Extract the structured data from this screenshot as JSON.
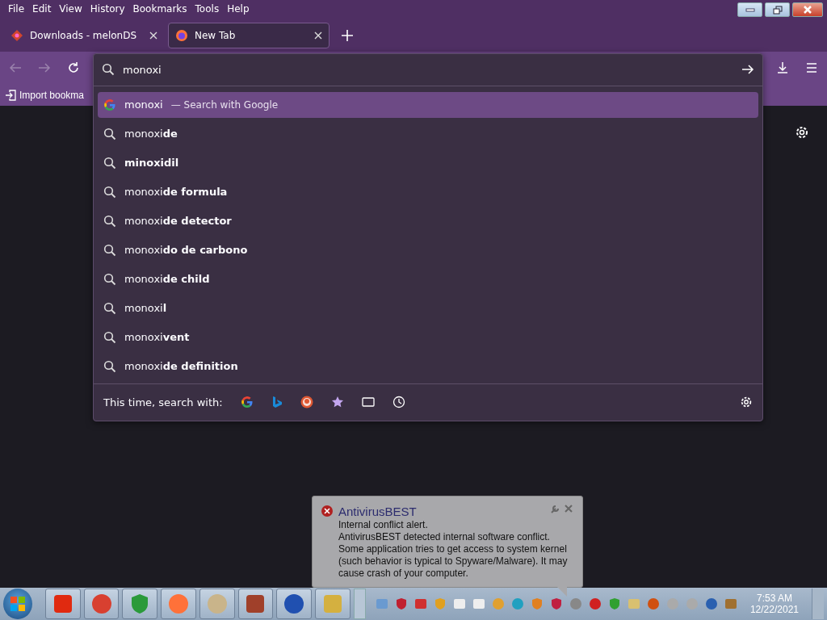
{
  "menu_bar": [
    "File",
    "Edit",
    "View",
    "History",
    "Bookmarks",
    "Tools",
    "Help"
  ],
  "tabs": [
    {
      "title": "Downloads - melonDS",
      "selected": false
    },
    {
      "title": "New Tab",
      "selected": true
    }
  ],
  "address_bar": {
    "value": "monoxi"
  },
  "bookmarks_bar": {
    "import_label": "Import bookma"
  },
  "suggestions": [
    {
      "kind": "engine",
      "text": "monoxi",
      "hint": "— Search with Google",
      "selected": true
    },
    {
      "kind": "search",
      "text": "monoxi**de**",
      "selected": false
    },
    {
      "kind": "search",
      "text": "**minoxidil**",
      "selected": false
    },
    {
      "kind": "search",
      "text": "monoxi**de formula**",
      "selected": false
    },
    {
      "kind": "search",
      "text": "monoxi**de detector**",
      "selected": false
    },
    {
      "kind": "search",
      "text": "monoxi**do de carbono**",
      "selected": false
    },
    {
      "kind": "search",
      "text": "monoxi**de child**",
      "selected": false
    },
    {
      "kind": "search",
      "text": "monoxi**l**",
      "selected": false
    },
    {
      "kind": "search",
      "text": "monoxi**vent**",
      "selected": false
    },
    {
      "kind": "search",
      "text": "monoxi**de definition**",
      "selected": false
    }
  ],
  "search_with_label": "This time, search with:",
  "notification": {
    "title": "AntivirusBEST",
    "lines": [
      "Internal conflict alert.",
      "AntivirusBEST detected internal software conflict. Some application tries to get access to system kernel (such behavior is typical to Spyware/Malware). It may cause crash of your computer."
    ]
  },
  "taskbar": {
    "time": "7:53 AM",
    "date": "12/22/2021"
  }
}
